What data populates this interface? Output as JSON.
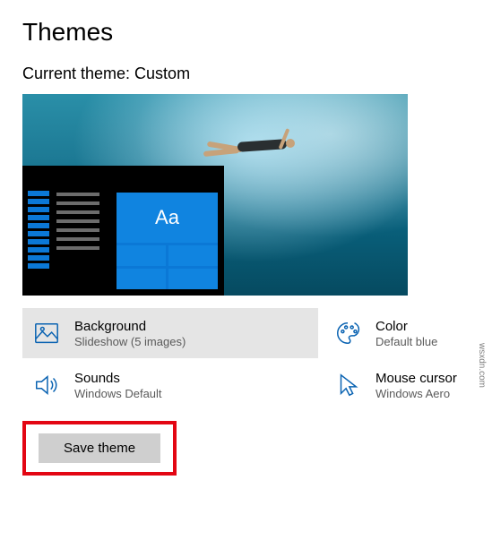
{
  "page": {
    "title": "Themes",
    "current_theme_label": "Current theme: Custom"
  },
  "preview": {
    "tile_label": "Aa"
  },
  "options": {
    "background": {
      "title": "Background",
      "value": "Slideshow (5 images)"
    },
    "color": {
      "title": "Color",
      "value": "Default blue"
    },
    "sounds": {
      "title": "Sounds",
      "value": "Windows Default"
    },
    "cursor": {
      "title": "Mouse cursor",
      "value": "Windows Aero"
    }
  },
  "actions": {
    "save_label": "Save theme"
  },
  "watermark": "wsxdn.com"
}
